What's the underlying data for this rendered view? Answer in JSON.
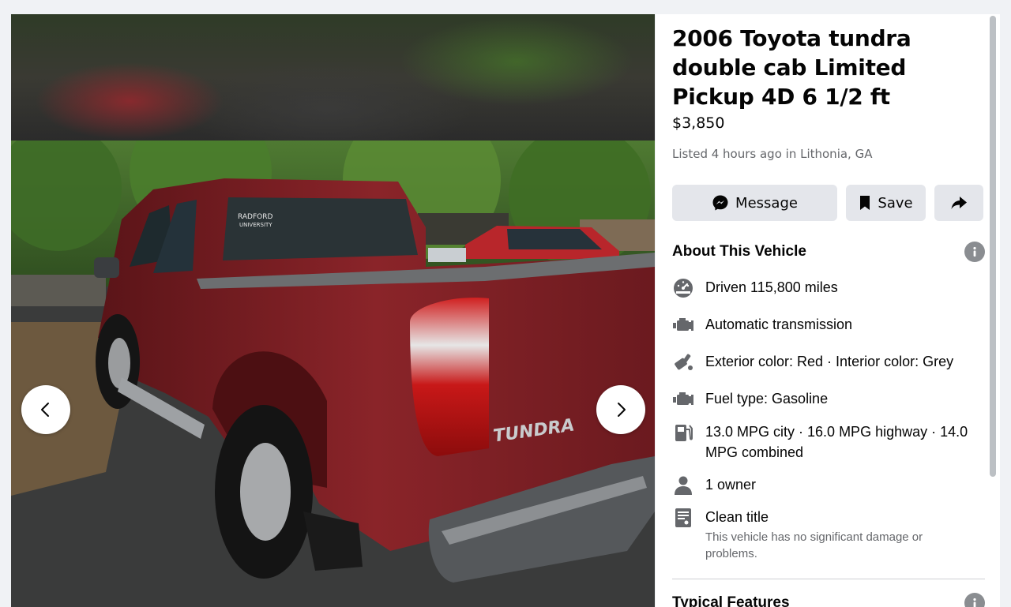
{
  "listing": {
    "title": "2006 Toyota tundra double cab Limited Pickup 4D 6 1/2 ft",
    "price": "$3,850",
    "listed": "Listed 4 hours ago in Lithonia, GA"
  },
  "actions": {
    "message_label": "Message",
    "save_label": "Save"
  },
  "about": {
    "heading": "About This Vehicle",
    "mileage": "Driven 115,800 miles",
    "transmission": "Automatic transmission",
    "colors": "Exterior color: Red · Interior color: Grey",
    "fuel": "Fuel type: Gasoline",
    "mpg": "13.0 MPG city · 16.0 MPG highway · 14.0 MPG combined",
    "owners": "1 owner",
    "title_status": "Clean title",
    "title_status_note": "This vehicle has no significant damage or problems."
  },
  "typical_features": {
    "heading": "Typical Features"
  },
  "photo": {
    "window_decal": "RADFORD UNIVERSITY",
    "badge": "TUNDRA"
  },
  "colors": {
    "button_bg": "#e4e6eb",
    "secondary_text": "#65676b",
    "icon_gray": "#65676b",
    "page_bg": "#f0f2f5",
    "truck_red": "#7e1d22"
  },
  "icons": [
    "chevron-left-icon",
    "chevron-right-icon",
    "messenger-icon",
    "bookmark-icon",
    "share-icon",
    "info-icon",
    "speedometer-icon",
    "engine-icon",
    "paint-icon",
    "fuel-pump-icon",
    "person-icon",
    "document-icon"
  ]
}
